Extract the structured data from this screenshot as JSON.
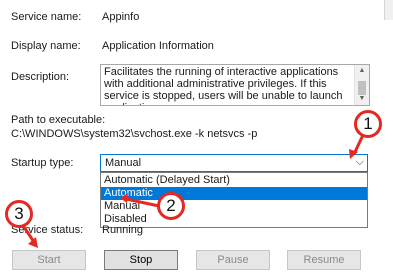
{
  "fields": {
    "service_name_label": "Service name:",
    "service_name_value": "Appinfo",
    "display_name_label": "Display name:",
    "display_name_value": "Application Information",
    "description_label": "Description:",
    "description_text": "Facilitates the running of interactive applications with additional administrative privileges.  If this service is stopped, users will be unable to launch applications",
    "path_label": "Path to executable:",
    "path_value": "C:\\WINDOWS\\system32\\svchost.exe -k netsvcs -p",
    "startup_type_label": "Startup type:",
    "service_status_label": "Service status:",
    "service_status_value": "Running"
  },
  "startup_select": {
    "selected": "Manual",
    "options": [
      "Automatic (Delayed Start)",
      "Automatic",
      "Manual",
      "Disabled"
    ],
    "highlighted": "Automatic"
  },
  "buttons": {
    "start": "Start",
    "stop": "Stop",
    "pause": "Pause",
    "resume": "Resume"
  },
  "callouts": {
    "one": "1",
    "two": "2",
    "three": "3"
  },
  "colors": {
    "accent": "#0078d7",
    "callout_red": "#e52821"
  }
}
